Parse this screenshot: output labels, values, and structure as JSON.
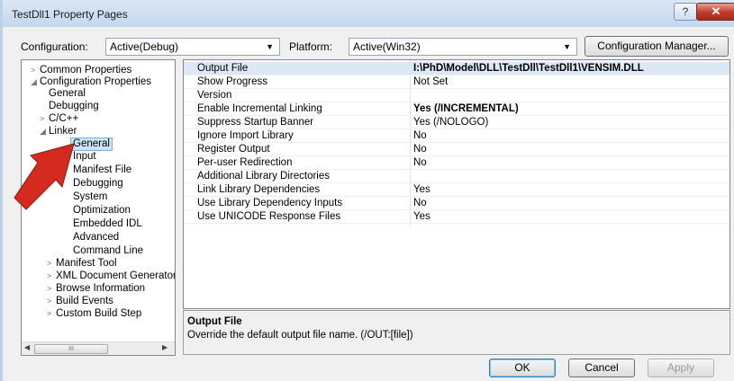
{
  "window": {
    "title": "TestDll1 Property Pages",
    "help_icon": "?",
    "close_icon": "✕"
  },
  "config_bar": {
    "configuration_label": "Configuration:",
    "configuration_value": "Active(Debug)",
    "platform_label": "Platform:",
    "platform_value": "Active(Win32)",
    "manager_button": "Configuration Manager..."
  },
  "tree": {
    "items": [
      {
        "label": "Common Properties",
        "expander": ">"
      },
      {
        "label": "Configuration Properties",
        "expander": "◢"
      },
      {
        "label": "General",
        "expander": ""
      },
      {
        "label": "Debugging",
        "expander": ""
      },
      {
        "label": "C/C++",
        "expander": ">"
      },
      {
        "label": "Linker",
        "expander": "◢"
      },
      {
        "label": "General",
        "expander": ""
      },
      {
        "label": "Input",
        "expander": ""
      },
      {
        "label": "Manifest File",
        "expander": ""
      },
      {
        "label": "Debugging",
        "expander": ""
      },
      {
        "label": "System",
        "expander": ""
      },
      {
        "label": "Optimization",
        "expander": ""
      },
      {
        "label": "Embedded IDL",
        "expander": ""
      },
      {
        "label": "Advanced",
        "expander": ""
      },
      {
        "label": "Command Line",
        "expander": ""
      },
      {
        "label": "Manifest Tool",
        "expander": ">"
      },
      {
        "label": "XML Document Generator",
        "expander": ">"
      },
      {
        "label": "Browse Information",
        "expander": ">"
      },
      {
        "label": "Build Events",
        "expander": ">"
      },
      {
        "label": "Custom Build Step",
        "expander": ">"
      }
    ],
    "scroll_thumb": "III"
  },
  "properties": [
    {
      "name": "Output File",
      "value": "I:\\PhD\\Model\\DLL\\TestDll\\TestDll1\\VENSIM.DLL",
      "bold": true
    },
    {
      "name": "Show Progress",
      "value": "Not Set",
      "bold": false
    },
    {
      "name": "Version",
      "value": "",
      "bold": false
    },
    {
      "name": "Enable Incremental Linking",
      "value": "Yes (/INCREMENTAL)",
      "bold": true
    },
    {
      "name": "Suppress Startup Banner",
      "value": "Yes (/NOLOGO)",
      "bold": false
    },
    {
      "name": "Ignore Import Library",
      "value": "No",
      "bold": false
    },
    {
      "name": "Register Output",
      "value": "No",
      "bold": false
    },
    {
      "name": "Per-user Redirection",
      "value": "No",
      "bold": false
    },
    {
      "name": "Additional Library Directories",
      "value": "",
      "bold": false
    },
    {
      "name": "Link Library Dependencies",
      "value": "Yes",
      "bold": false
    },
    {
      "name": "Use Library Dependency Inputs",
      "value": "No",
      "bold": false
    },
    {
      "name": "Use UNICODE Response Files",
      "value": "Yes",
      "bold": false
    }
  ],
  "description": {
    "title": "Output File",
    "text": "Override the default output file name.     (/OUT:[file])"
  },
  "buttons": {
    "ok": "OK",
    "cancel": "Cancel",
    "apply": "Apply"
  },
  "colors": {
    "annotation_arrow": "#d42a1f",
    "selection": "#cde3f8"
  }
}
